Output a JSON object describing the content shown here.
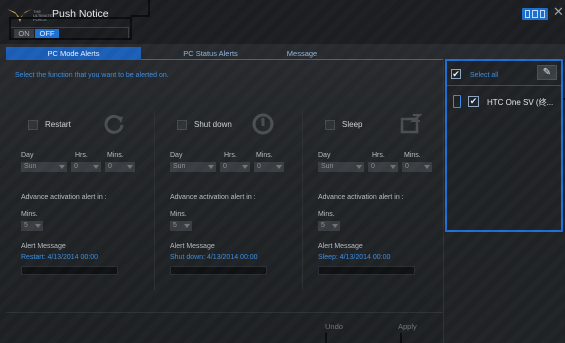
{
  "app": {
    "title": "Push Notice",
    "logo_text": "THE ULTIMATE FORCE"
  },
  "toggle": {
    "on_label": "ON",
    "off_label": "OFF"
  },
  "tabs": [
    {
      "label": "PC Mode Alerts",
      "active": true
    },
    {
      "label": "PC Status Alerts",
      "active": false
    },
    {
      "label": "Message",
      "active": false
    }
  ],
  "intro": "Select the function that you want to be alerted on.",
  "columns": [
    {
      "name": "Restart",
      "icon": "restart-icon",
      "day_label": "Day",
      "hrs_label": "Hrs.",
      "mins_label": "Mins.",
      "day": "Sun",
      "hrs": "0",
      "mins": "0",
      "advance_label": "Advance activation alert in :",
      "adv_mins_label": "Mins.",
      "adv_mins": "5",
      "alert_label": "Alert Message",
      "alert_text": "Restart: 4/13/2014 00:00"
    },
    {
      "name": "Shut down",
      "icon": "power-icon",
      "day_label": "Day",
      "hrs_label": "Hrs.",
      "mins_label": "Mins.",
      "day": "Sun",
      "hrs": "0",
      "mins": "0",
      "advance_label": "Advance activation alert in :",
      "adv_mins_label": "Mins.",
      "adv_mins": "5",
      "alert_label": "Alert Message",
      "alert_text": "Shut down: 4/13/2014 00:00"
    },
    {
      "name": "Sleep",
      "icon": "sleep-icon",
      "day_label": "Day",
      "hrs_label": "Hrs.",
      "mins_label": "Mins.",
      "day": "Sun",
      "hrs": "0",
      "mins": "0",
      "advance_label": "Advance activation alert in :",
      "adv_mins_label": "Mins.",
      "adv_mins": "5",
      "alert_label": "Alert Message",
      "alert_text": "Sleep: 4/13/2014 00:00"
    }
  ],
  "actions": {
    "undo": "Undo",
    "apply": "Apply"
  },
  "devices": {
    "select_all": "Select all",
    "items": [
      {
        "name": "HTC One SV (终..."
      }
    ]
  },
  "colors": {
    "accent": "#1c6fd6",
    "link_text": "#3d8fe3",
    "highlight_frame": "#1f6fd8",
    "callout": "#0a0c0e"
  }
}
